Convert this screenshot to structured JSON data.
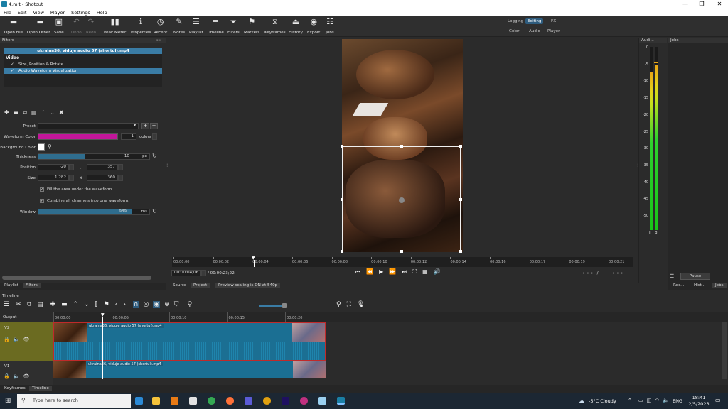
{
  "window": {
    "title": "4.mlt - Shotcut",
    "minimize": "—",
    "maximize": "❐",
    "close": "✕"
  },
  "menu": [
    "File",
    "Edit",
    "View",
    "Player",
    "Settings",
    "Help"
  ],
  "toolbar": [
    {
      "label": "Open File",
      "icon": "folder-open-icon",
      "glyph": "▬"
    },
    {
      "label": "Open Other...",
      "icon": "open-other-icon",
      "glyph": "▬"
    },
    {
      "label": "Save",
      "icon": "save-icon",
      "glyph": "▣"
    },
    {
      "label": "Undo",
      "icon": "undo-icon",
      "glyph": "↶",
      "dim": true
    },
    {
      "label": "Redo",
      "icon": "redo-icon",
      "glyph": "↷",
      "dim": true
    },
    {
      "label": "Peak Meter",
      "icon": "peak-meter-icon",
      "glyph": "▮▮"
    },
    {
      "label": "Properties",
      "icon": "properties-icon",
      "glyph": "ℹ"
    },
    {
      "label": "Recent",
      "icon": "recent-icon",
      "glyph": "◷"
    },
    {
      "label": "Notes",
      "icon": "notes-icon",
      "glyph": "✎"
    },
    {
      "label": "Playlist",
      "icon": "playlist-icon",
      "glyph": "☰"
    },
    {
      "label": "Timeline",
      "icon": "timeline-icon",
      "glyph": "≡"
    },
    {
      "label": "Filters",
      "icon": "filter-icon",
      "glyph": "⏷"
    },
    {
      "label": "Markers",
      "icon": "markers-icon",
      "glyph": "⚑"
    },
    {
      "label": "Keyframes",
      "icon": "keyframes-icon",
      "glyph": "⧖"
    },
    {
      "label": "History",
      "icon": "history-icon",
      "glyph": "⏏"
    },
    {
      "label": "Export",
      "icon": "export-icon",
      "glyph": "◉"
    },
    {
      "label": "Jobs",
      "icon": "jobs-icon",
      "glyph": "☷"
    }
  ],
  "layouts": {
    "top": [
      "Logging",
      "Editing",
      "FX"
    ],
    "bottom": [
      "Color",
      "Audio",
      "Player"
    ],
    "active": "Editing"
  },
  "filters": {
    "title": "Filters",
    "clip": "ukraina36, viduje audio 57 (shortul).mp4",
    "category": "Video",
    "items": [
      {
        "check": "✓",
        "label": "Size, Position & Rotate"
      },
      {
        "check": "✓",
        "label": "Audio Waveform Visualization"
      }
    ],
    "preset_label": "Preset",
    "waveform_color_label": "Waveform Color",
    "waveform_color": "#c2169a",
    "colors_count": "1",
    "colors_unit": "colors",
    "background_color_label": "Background Color",
    "background_color": "#ffffff",
    "thickness_label": "Thickness",
    "thickness": "10",
    "thickness_unit": "px",
    "thickness_fraction": 0.42,
    "position_label": "Position",
    "position_x": "-20",
    "position_y": "357",
    "position_sep": ",",
    "size_label": "Size",
    "size_w": "1,282",
    "size_h": "360",
    "size_sep": "x",
    "fill_label": "Fill the area under the waveform.",
    "combine_label": "Combine all channels into one waveform.",
    "window_label": "Window",
    "window": "989",
    "window_unit": "ms",
    "window_fraction": 0.84
  },
  "left_tabs": [
    "Playlist",
    "Filters"
  ],
  "player": {
    "ruler": [
      "00:00:00",
      "00:00:02",
      "00:00:04",
      "00:00:06",
      "00:00:08",
      "00:00:10",
      "00:00:12",
      "00:00:14",
      "00:00:16",
      "00:00:17",
      "00:00:19",
      "00:00:21"
    ],
    "current_time": "00:00:04;06",
    "total_time": "/ 00:00:23;22",
    "in_point": "--:--:--:-- /",
    "out_point": "--:--:--:--",
    "tabs": [
      "Source",
      "Project"
    ],
    "scaling": "Preview scaling is ON at 540p"
  },
  "audio": {
    "title": "Audi...",
    "scale": [
      "0",
      "-5",
      "-10",
      "-15",
      "-20",
      "-25",
      "-30",
      "-35",
      "-40",
      "-45",
      "-50"
    ],
    "channels": [
      "L",
      "R"
    ],
    "left_level": 0.86,
    "right_level": 0.9
  },
  "jobs": {
    "title": "Jobs",
    "pause": "Pause",
    "tabs": [
      "Rec...",
      "Hist...",
      "Jobs"
    ]
  },
  "timeline": {
    "title": "Timeline",
    "output": "Output",
    "ruler": [
      "00:00:00",
      "00:00:05",
      "00:00:10",
      "00:00:15",
      "00:00:20"
    ],
    "tracks": [
      {
        "name": "V2",
        "clip": "ukraina36, viduje audio 57 (shortul).mp4"
      },
      {
        "name": "V1",
        "clip": "ukraina36, viduje audio 57 (shortul).mp4"
      }
    ]
  },
  "bottom_tabs": [
    "Keyframes",
    "Timeline"
  ],
  "taskbar": {
    "search": "Type here to search",
    "weather": "-5°C  Cloudy",
    "lang": "ENG",
    "time": "18:41",
    "date": "2/5/2023"
  }
}
